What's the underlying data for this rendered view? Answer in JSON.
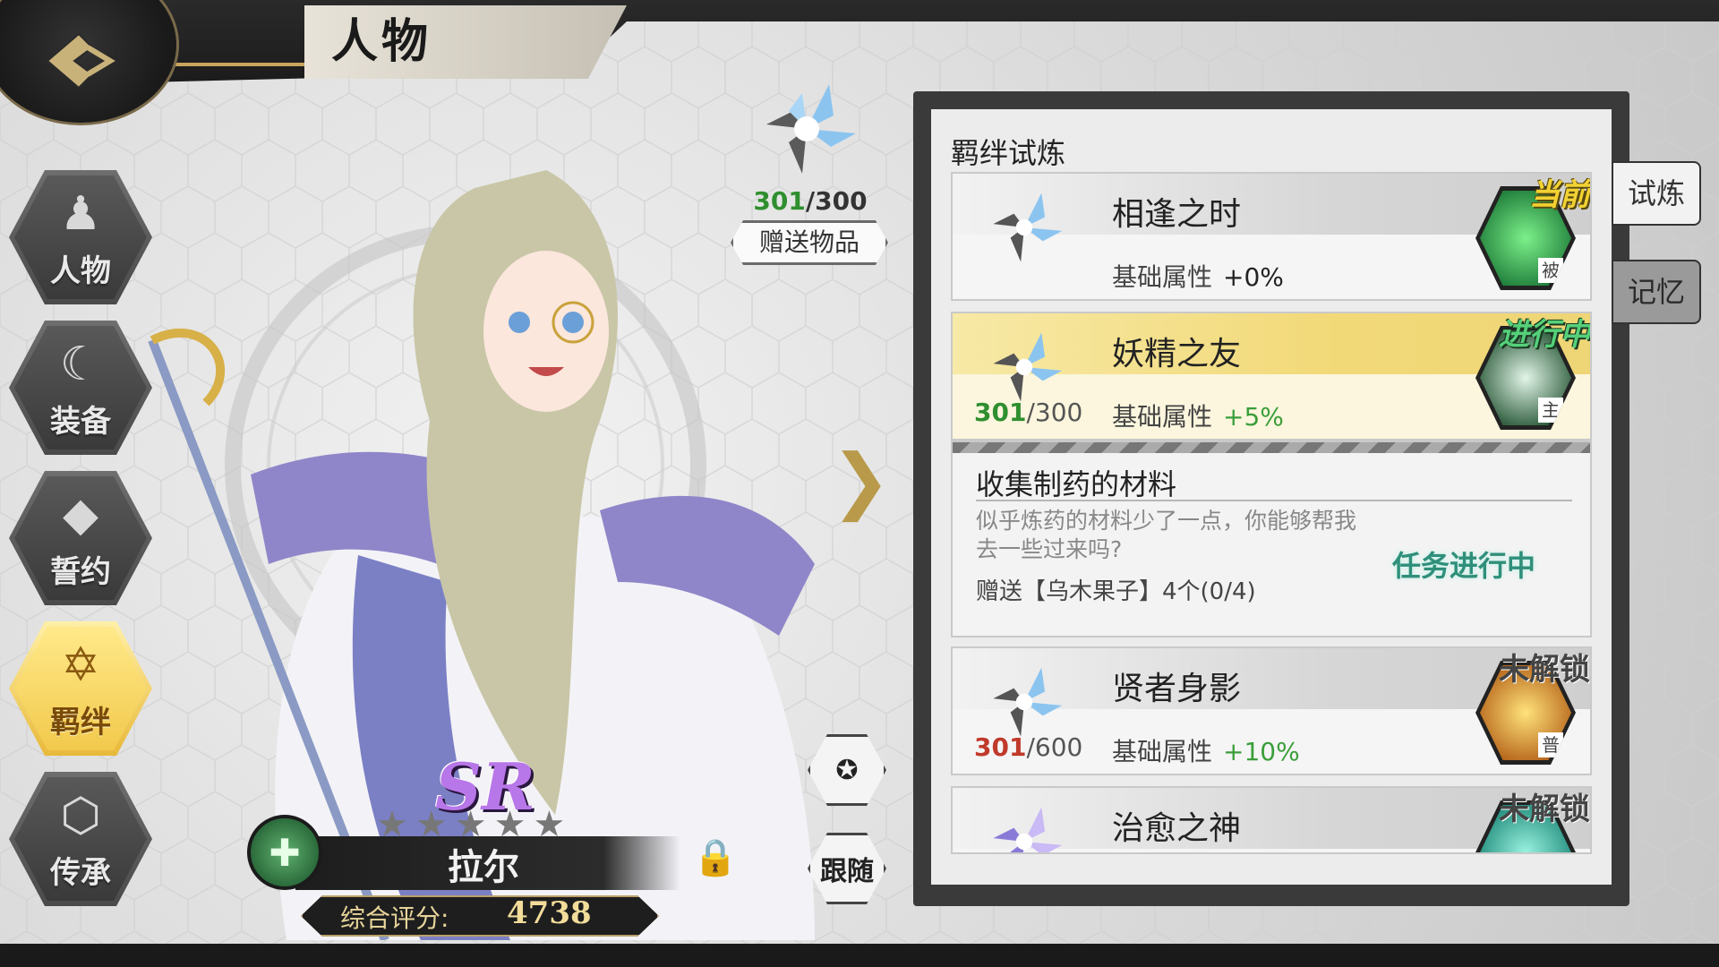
{
  "header": {
    "title": "人物",
    "back_icon": "back-arrow-icon"
  },
  "nav": [
    {
      "label": "人物",
      "icon": "character-icon",
      "active": false
    },
    {
      "label": "装备",
      "icon": "equipment-icon",
      "active": false
    },
    {
      "label": "誓约",
      "icon": "crystal-icon",
      "active": false
    },
    {
      "label": "羁绊",
      "icon": "bond-star-icon",
      "active": true
    },
    {
      "label": "传承",
      "icon": "inheritance-icon",
      "active": false
    }
  ],
  "gift": {
    "current": "301",
    "max": "/300",
    "button_label": "赠送物品"
  },
  "character": {
    "rarity": "SR",
    "stars": "★★★★★",
    "name": "拉尔",
    "score_label": "综合评分:",
    "score_value": "4738"
  },
  "actions": {
    "favorite_icon": "star-icon",
    "follow_label": "跟随"
  },
  "panel": {
    "title": "羁绊试炼",
    "trials": [
      {
        "title": "相逢之时",
        "stat_label": "基础属性",
        "bonus": "+0%",
        "status": "当前",
        "tag": "被",
        "count_current": "",
        "count_max": ""
      },
      {
        "title": "妖精之友",
        "stat_label": "基础属性",
        "bonus": "+5%",
        "status": "进行中",
        "tag": "主",
        "count_current": "301",
        "count_max": "/300"
      },
      {
        "title": "贤者身影",
        "stat_label": "基础属性",
        "bonus": "+10%",
        "status": "未解锁",
        "tag": "普",
        "count_current": "301",
        "count_max": "/600"
      },
      {
        "title": "治愈之神",
        "stat_label": "",
        "bonus": "",
        "status": "未解锁",
        "tag": "",
        "count_current": "",
        "count_max": ""
      }
    ],
    "quest": {
      "title": "收集制药的材料",
      "description": "似乎炼药的材料少了一点，你能够帮我去一些过来吗?",
      "requirement": "赠送【乌木果子】4个(0/4)",
      "status": "任务进行中"
    }
  },
  "side_tabs": [
    {
      "label": "试炼",
      "active": true
    },
    {
      "label": "记忆",
      "active": false
    }
  ],
  "colors": {
    "gold": "#c8a45c",
    "green": "#3b9e3b",
    "purple": "#b877e8"
  }
}
